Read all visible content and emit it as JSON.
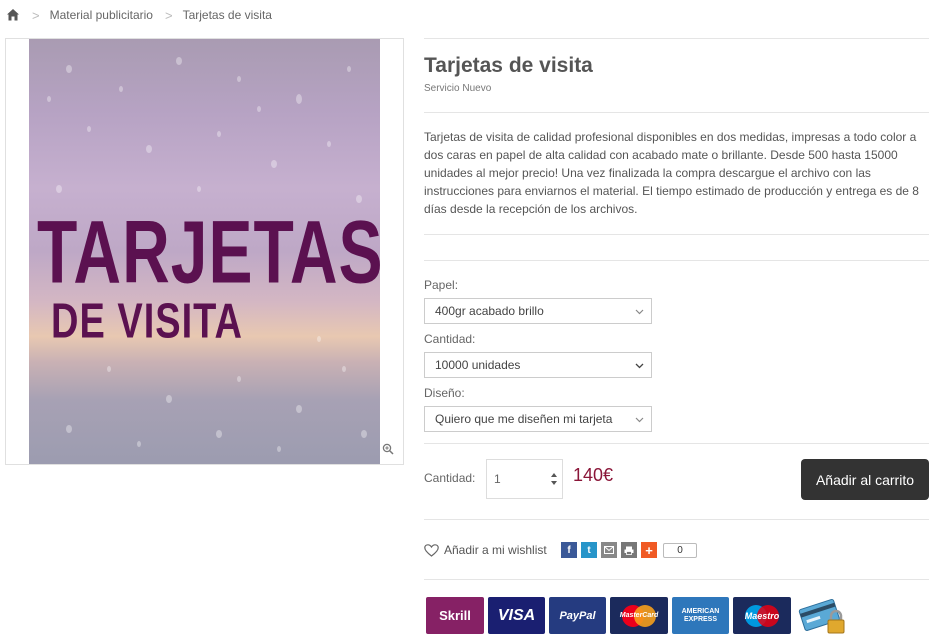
{
  "breadcrumb": {
    "items": [
      "Material publicitario",
      "Tarjetas de visita"
    ]
  },
  "image": {
    "line1": "TARJETAS",
    "line2": "DE VISITA"
  },
  "product": {
    "title": "Tarjetas de visita",
    "subtitle": "Servicio Nuevo",
    "description": "Tarjetas de visita de calidad profesional disponibles en dos medidas, impresas a todo color a dos caras en papel de alta calidad con acabado mate o brillante. Desde 500 hasta 15000 unidades al mejor precio! Una vez finalizada la compra descargue el archivo con las instrucciones para enviarnos el material. El tiempo estimado de producción y entrega es de 8 días desde la recepción de los archivos."
  },
  "options": [
    {
      "label": "Papel:",
      "value": "400gr acabado brillo"
    },
    {
      "label": "Cantidad:",
      "value": "10000 unidades"
    },
    {
      "label": "Diseño:",
      "value": "Quiero que me diseñen mi tarjeta"
    }
  ],
  "purchase": {
    "qty_label": "Cantidad:",
    "qty_value": "1",
    "price": "140€",
    "cart_label": "Añadir al carrito"
  },
  "wishlist": {
    "label": "Añadir a mi wishlist",
    "share_count": "0"
  },
  "payments": [
    "Skrill",
    "VISA",
    "PayPal",
    "MasterCard",
    "AMERICAN EXPRESS",
    "Maestro"
  ],
  "colors": {
    "price": "#8a1538",
    "cart_button": "#333333",
    "poster_text": "#5b1150"
  }
}
